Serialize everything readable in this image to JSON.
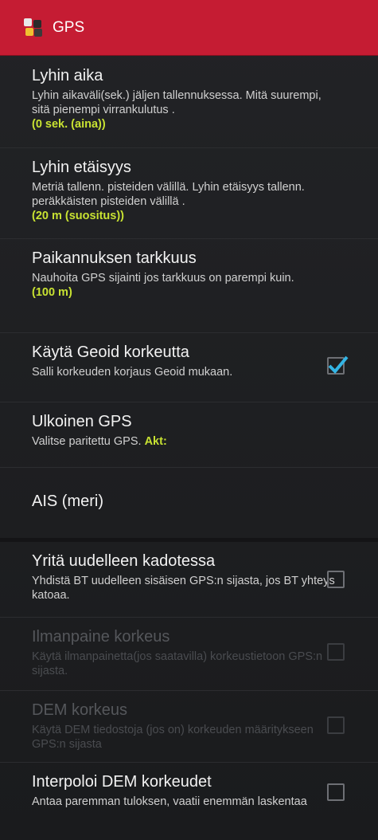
{
  "header": {
    "title": "GPS"
  },
  "items": [
    {
      "title": "Lyhin aika",
      "summary": "Lyhin aikaväli(sek.) jäljen tallennuksessa. Mitä suurempi, sitä pienempi virrankulutus .",
      "value": "(0 sek. (aina))"
    },
    {
      "title": "Lyhin etäisyys",
      "summary": "Metriä tallenn. pisteiden välillä. Lyhin etäisyys tallenn. peräkkäisten pisteiden välillä .",
      "value": "(20 m (suositus))"
    },
    {
      "title": "Paikannuksen tarkkuus",
      "summary": "Nauhoita GPS sijainti jos tarkkuus on parempi kuin.",
      "value": "(100 m)"
    },
    {
      "title": "Käytä Geoid korkeutta",
      "summary": "Salli korkeuden korjaus Geoid mukaan.",
      "checked": true
    },
    {
      "title": "Ulkoinen GPS",
      "summary": "Valitse paritettu GPS.",
      "summary_highlight": "Akt:"
    },
    {
      "title": "AIS (meri)"
    },
    {
      "title": "Yritä uudelleen kadotessa",
      "summary": "Yhdistä BT uudelleen sisäisen GPS:n sijasta, jos BT yhteys katoaa.",
      "checked": false
    },
    {
      "title": "Ilmanpaine korkeus",
      "summary": "Käytä ilmanpainetta(jos saatavilla) korkeustietoon GPS:n sijasta.",
      "checked": false,
      "enabled": false
    },
    {
      "title": "DEM korkeus",
      "summary": "Käytä DEM tiedostoja (jos on) korkeuden määritykseen GPS:n sijasta",
      "checked": false,
      "enabled": false
    },
    {
      "title": "Interpoloi DEM korkeudet",
      "summary": "Antaa paremman tuloksen, vaatii enemmän laskentaa",
      "checked": false
    }
  ],
  "colors": {
    "titlebar": "#c51c33",
    "accent": "#c8e232",
    "check": "#33b5e5"
  }
}
